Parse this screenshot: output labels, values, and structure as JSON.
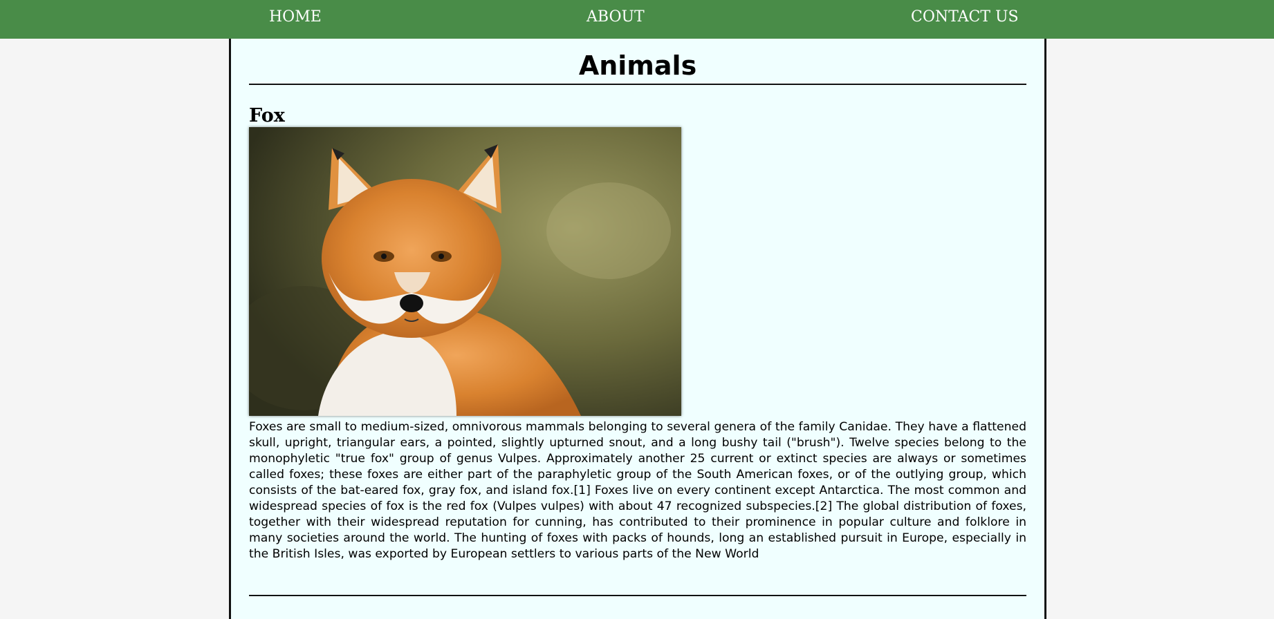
{
  "nav": {
    "home": "HOME",
    "about": "ABOUT",
    "contact": "CONTACT US"
  },
  "page": {
    "title": "Animals"
  },
  "article": {
    "heading": "Fox",
    "image_alt": "Red fox portrait",
    "text": "Foxes are small to medium-sized, omnivorous mammals belonging to several genera of the family Canidae. They have a flattened skull, upright, triangular ears, a pointed, slightly upturned snout, and a long bushy tail (\"brush\"). Twelve species belong to the monophyletic \"true fox\" group of genus Vulpes. Approximately another 25 current or extinct species are always or sometimes called foxes; these foxes are either part of the paraphyletic group of the South American foxes, or of the outlying group, which consists of the bat-eared fox, gray fox, and island fox.[1] Foxes live on every continent except Antarctica. The most common and widespread species of fox is the red fox (Vulpes vulpes) with about 47 recognized subspecies.[2] The global distribution of foxes, together with their widespread reputation for cunning, has contributed to their prominence in popular culture and folklore in many societies around the world. The hunting of foxes with packs of hounds, long an established pursuit in Europe, especially in the British Isles, was exported by European settlers to various parts of the New World"
  },
  "colors": {
    "nav_background": "#498c48",
    "content_background": "#f0ffff",
    "page_background": "#f5f5f5"
  }
}
